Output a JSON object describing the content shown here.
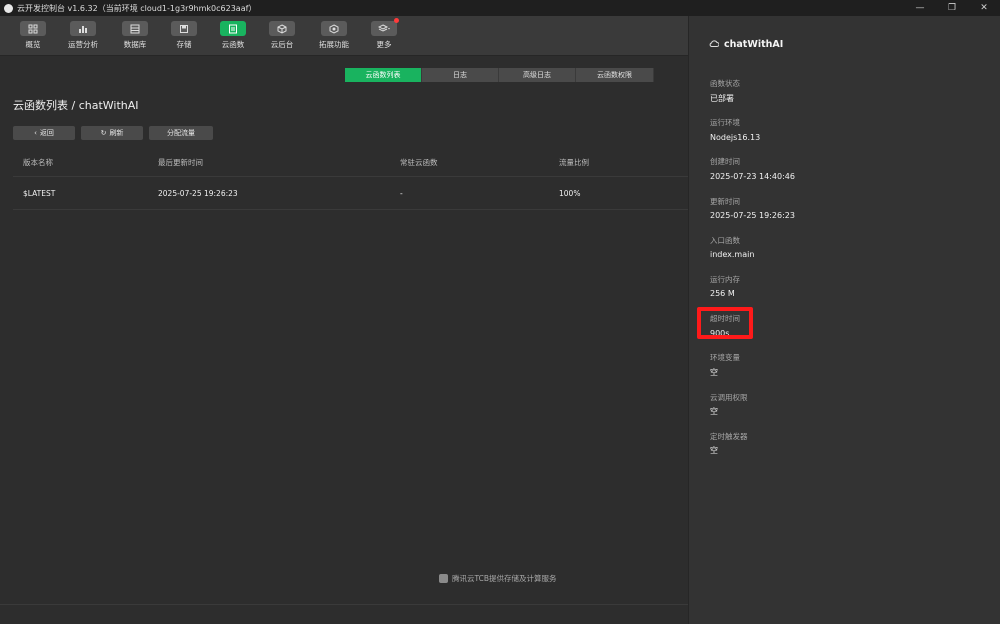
{
  "window": {
    "title": "云开发控制台 v1.6.32（当前环境 cloud1-1g3r9hmk0c623aaf）",
    "controls": [
      "minimize",
      "restore",
      "close"
    ]
  },
  "toolbar": {
    "items": [
      {
        "label": "概览",
        "icon": "grid-icon"
      },
      {
        "label": "运营分析",
        "icon": "bar-chart-icon"
      },
      {
        "label": "数据库",
        "icon": "table-icon"
      },
      {
        "label": "存储",
        "icon": "storage-icon"
      },
      {
        "label": "云函数",
        "icon": "function-icon",
        "active": true
      },
      {
        "label": "云后台",
        "icon": "cube-icon"
      },
      {
        "label": "拓展功能",
        "icon": "hexagon-icon"
      },
      {
        "label": "更多",
        "icon": "layers-icon",
        "badge": true
      }
    ],
    "accent": "#19b35f"
  },
  "tabs": [
    {
      "label": "云函数列表",
      "active": true
    },
    {
      "label": "日志"
    },
    {
      "label": "高级日志"
    },
    {
      "label": "云函数权限"
    }
  ],
  "page": {
    "title": "云函数列表 / chatWithAI",
    "buttons": {
      "back": "返回",
      "refresh": "刷新",
      "allocate": "分配流量"
    }
  },
  "table": {
    "columns": [
      "版本名称",
      "最后更新时间",
      "常驻云函数",
      "流量比例"
    ],
    "rows": [
      [
        "$LATEST",
        "2025-07-25 19:26:23",
        "-",
        "100%"
      ]
    ]
  },
  "footer": {
    "text": "腾讯云TCB提供存储及计算服务"
  },
  "sidebar": {
    "title": "chatWithAI",
    "fields": [
      {
        "label": "函数状态",
        "value": "已部署"
      },
      {
        "label": "运行环境",
        "value": "Nodejs16.13"
      },
      {
        "label": "创建时间",
        "value": "2025-07-23 14:40:46"
      },
      {
        "label": "更新时间",
        "value": "2025-07-25 19:26:23"
      },
      {
        "label": "入口函数",
        "value": "index.main"
      },
      {
        "label": "运行内存",
        "value": "256 M"
      },
      {
        "label": "超时时间",
        "value": "900s"
      },
      {
        "label": "环境变量",
        "value": "空"
      },
      {
        "label": "云调用权限",
        "value": "空"
      },
      {
        "label": "定时触发器",
        "value": "空"
      }
    ],
    "highlight_color": "#ff1a1a"
  }
}
